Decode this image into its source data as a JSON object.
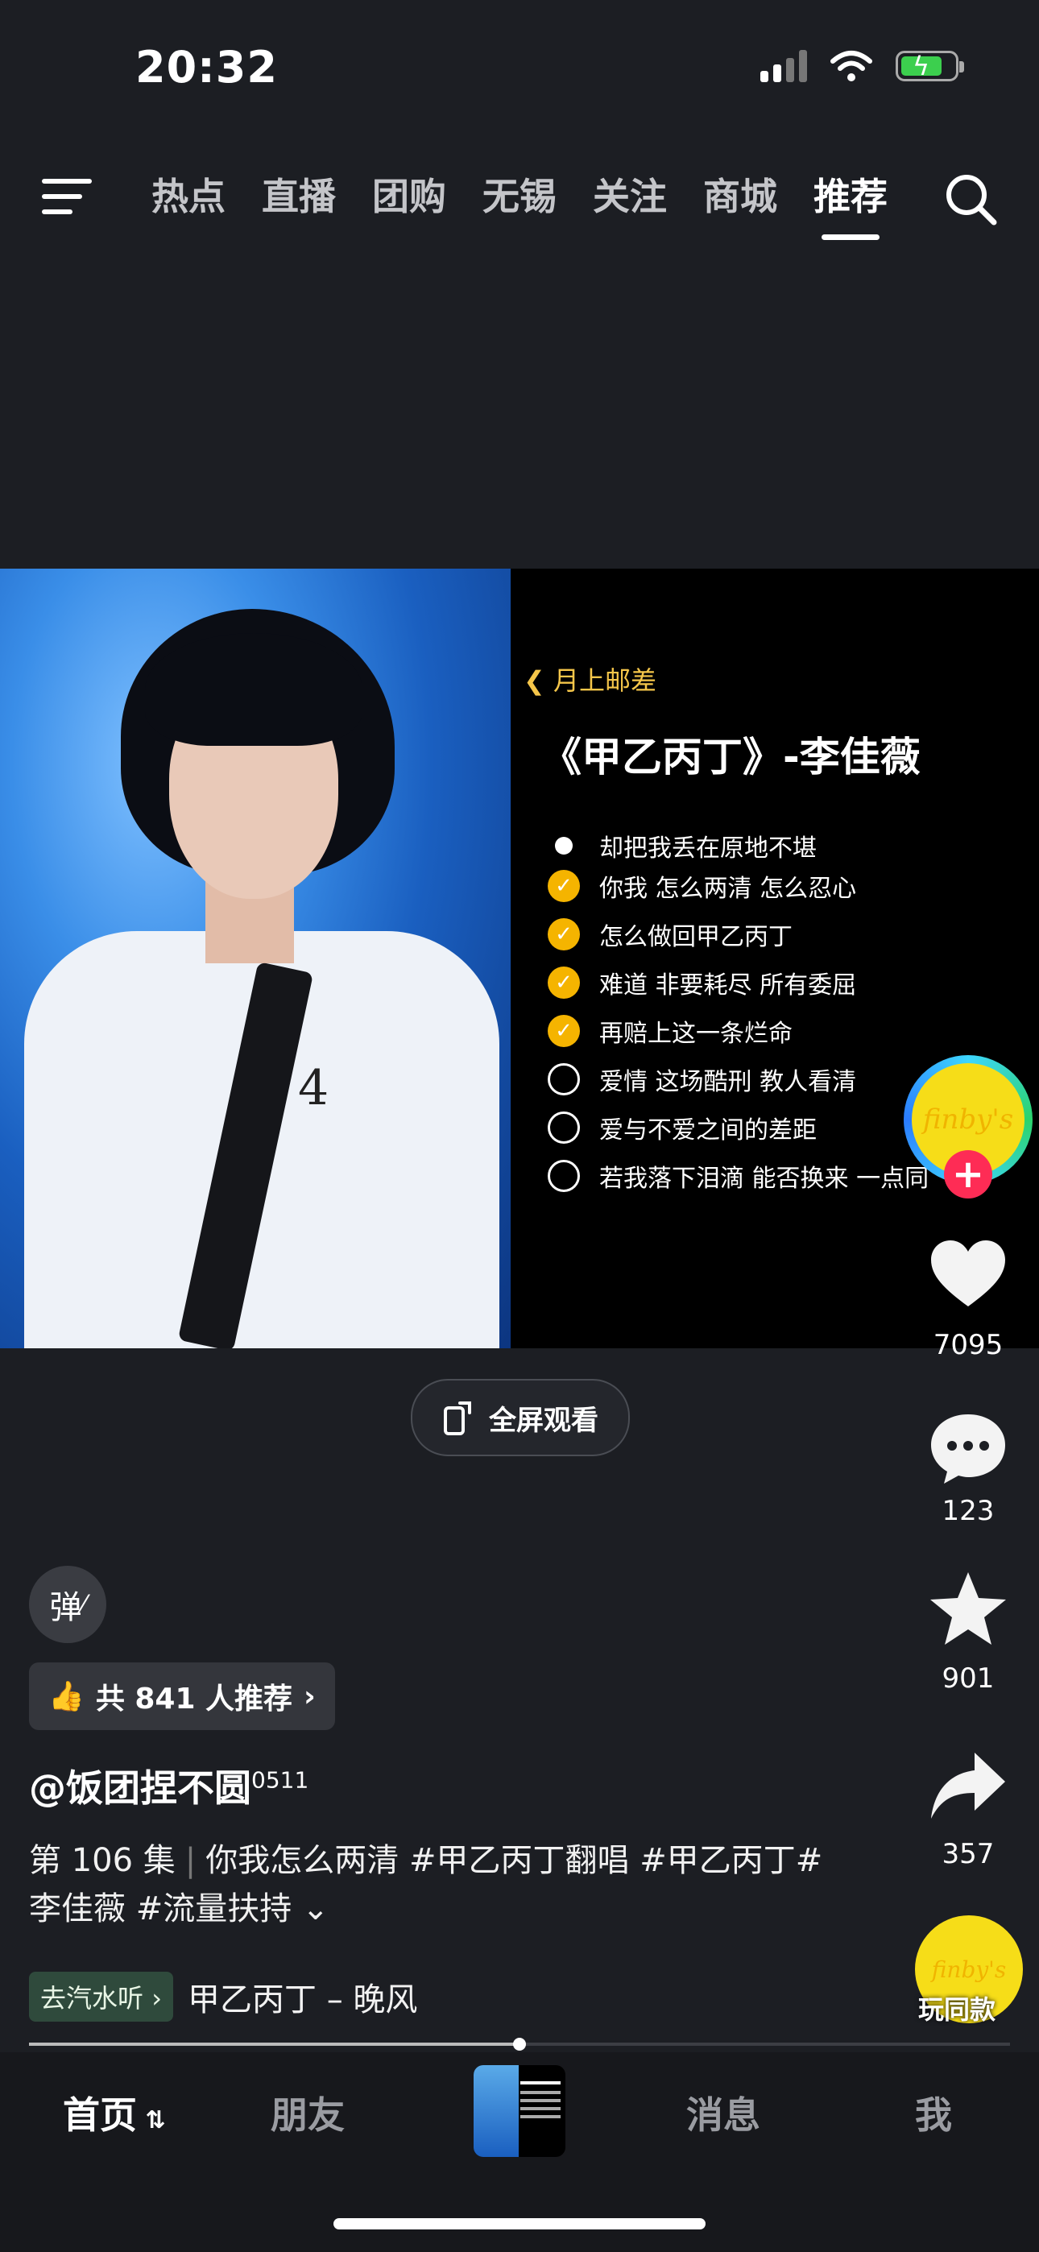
{
  "status_bar": {
    "time": "20:32"
  },
  "top_nav": {
    "tabs": [
      {
        "label": "热点"
      },
      {
        "label": "直播"
      },
      {
        "label": "团购"
      },
      {
        "label": "无锡"
      },
      {
        "label": "关注"
      },
      {
        "label": "商城"
      },
      {
        "label": "推荐",
        "active": true
      }
    ]
  },
  "lyrics_panel": {
    "back_label": "月上邮差",
    "title": "《甲乙丙丁》-李佳薇",
    "lines": [
      {
        "text": "却把我丢在原地不堪",
        "state": "current"
      },
      {
        "text": "你我 怎么两清 怎么忍心",
        "state": "done"
      },
      {
        "text": "怎么做回甲乙丙丁",
        "state": "done"
      },
      {
        "text": "难道 非要耗尽 所有委屈",
        "state": "done"
      },
      {
        "text": "再赔上这一条烂命",
        "state": "done"
      },
      {
        "text": "爱情 这场酷刑 教人看清",
        "state": "todo"
      },
      {
        "text": "爱与不爱之间的差距",
        "state": "todo"
      },
      {
        "text": "若我落下泪滴 能否换来 一点同",
        "state": "todo"
      }
    ]
  },
  "fullscreen_label": "全屏观看",
  "sidebar": {
    "avatar_text": "finby's",
    "likes": "7095",
    "comments": "123",
    "favorites": "901",
    "shares": "357",
    "play_same_label": "玩同款",
    "disc_text": "finby's"
  },
  "post": {
    "danmu_label": "弹",
    "recommend_label": "共 841 人推荐",
    "username": "@饭团捏不圆",
    "username_suffix": "0511",
    "episode": "第 106 集",
    "caption": "你我怎么两清 #甲乙丙丁翻唱 #甲乙丙丁#李佳薇 #流量扶持",
    "music_tag": "去汽水听",
    "music_name": "甲乙丙丁 – 晚风"
  },
  "progress": 0.5,
  "bottom_tabs": {
    "home": "首页",
    "friends": "朋友",
    "messages": "消息",
    "me": "我"
  }
}
